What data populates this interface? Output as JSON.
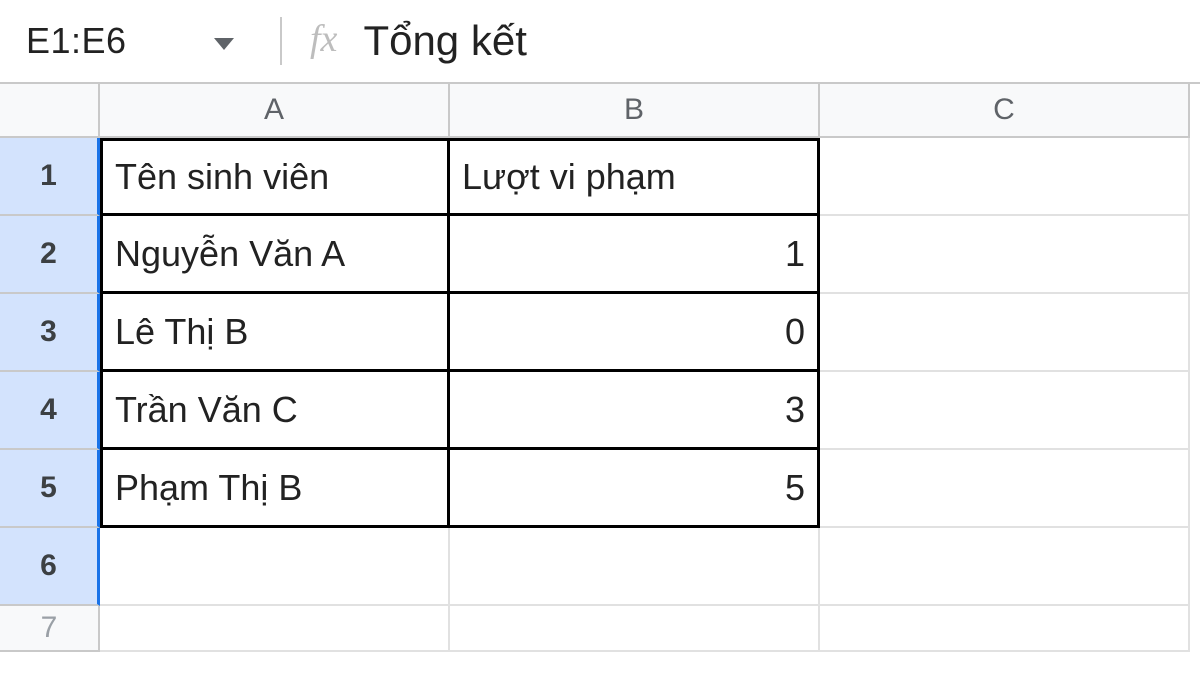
{
  "namebox": {
    "value": "E1:E6"
  },
  "formula": {
    "fx_label": "fx",
    "value": "Tổng kết"
  },
  "columns": {
    "A": "A",
    "B": "B",
    "C": "C"
  },
  "row_numbers": [
    "1",
    "2",
    "3",
    "4",
    "5",
    "6",
    "7"
  ],
  "table": {
    "header": {
      "A": "Tên sinh viên",
      "B": "Lượt vi phạm"
    },
    "rows": [
      {
        "A": "Nguyễn Văn A",
        "B": "1"
      },
      {
        "A": "Lê Thị B",
        "B": "0"
      },
      {
        "A": "Trần Văn C",
        "B": "3"
      },
      {
        "A": "Phạm Thị B",
        "B": "5"
      }
    ]
  }
}
